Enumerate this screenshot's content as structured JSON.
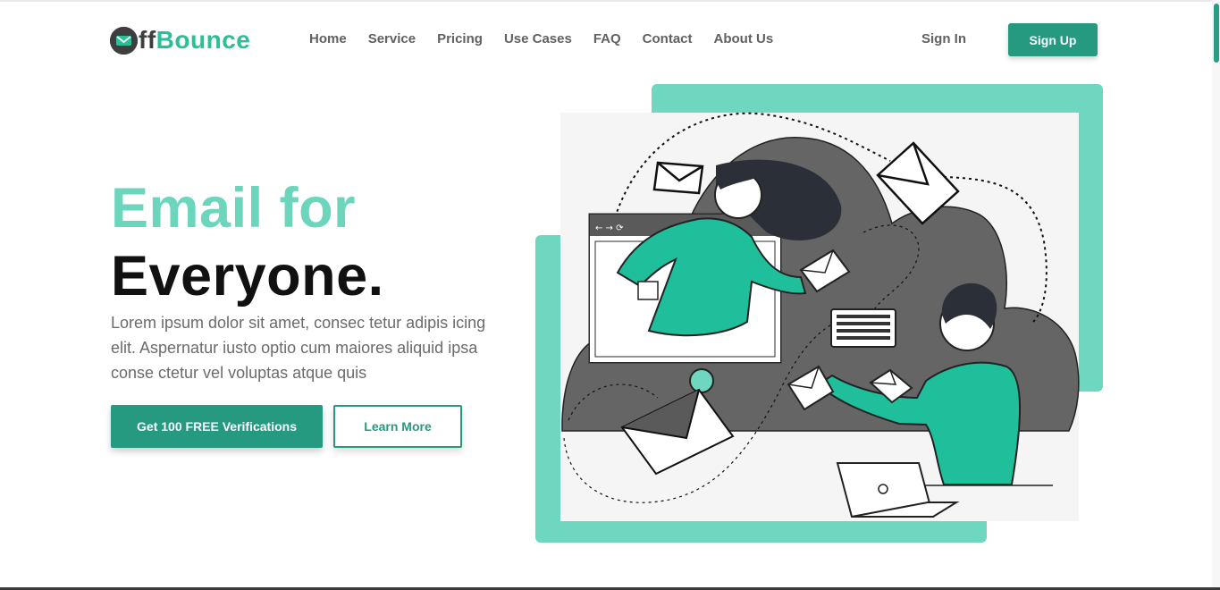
{
  "brand": {
    "logo_text_dark": "ff",
    "logo_text_accent": "Bounce",
    "accent": "#2bbf98",
    "primary": "#269a81",
    "hero_accent": "#6cd6bd"
  },
  "nav": {
    "items": [
      {
        "label": "Home"
      },
      {
        "label": "Service"
      },
      {
        "label": "Pricing"
      },
      {
        "label": "Use Cases"
      },
      {
        "label": "FAQ"
      },
      {
        "label": "Contact"
      },
      {
        "label": "About Us"
      }
    ],
    "sign_in": "Sign In",
    "sign_up": "Sign Up"
  },
  "hero": {
    "title_line1": "Email for",
    "title_line2": "Everyone.",
    "description": "Lorem ipsum dolor sit amet, consec tetur adipis icing elit. Aspernatur iusto optio cum maiores aliquid ipsa conse ctetur vel voluptas atque quis",
    "cta_primary": "Get 100 FREE Verifications",
    "cta_secondary": "Learn More"
  },
  "illustration": {
    "icon": "email-exchange-illustration"
  }
}
